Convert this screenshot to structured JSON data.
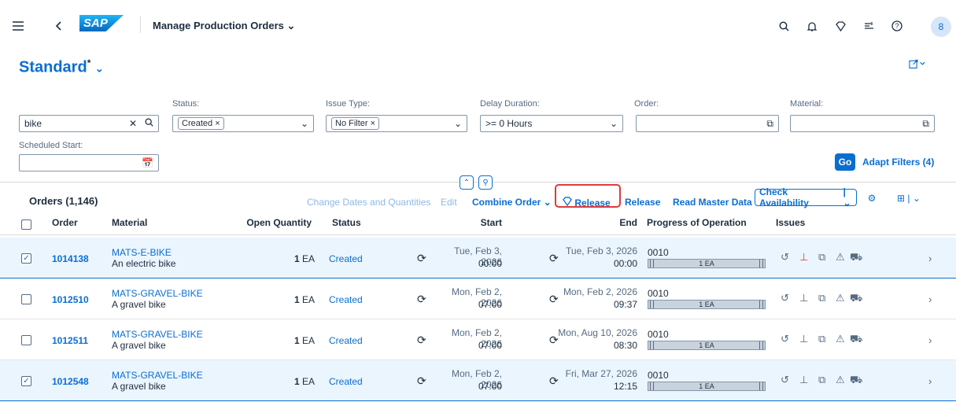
{
  "shell": {
    "logo": "SAP",
    "title": "Manage Production Orders",
    "avatar": "8"
  },
  "variant": {
    "name": "Standard",
    "modified": "*"
  },
  "filters": {
    "search_value": "bike",
    "status_label": "Status:",
    "status_token": "Created",
    "issue_label": "Issue Type:",
    "issue_token": "No Filter",
    "delay_label": "Delay Duration:",
    "delay_value": ">= 0 Hours",
    "order_label": "Order:",
    "material_label": "Material:",
    "sched_label": "Scheduled Start:",
    "go": "Go",
    "adapt": "Adapt Filters (4)"
  },
  "toolbar": {
    "title": "Orders (1,146)",
    "change_dates": "Change Dates and Quantities",
    "edit": "Edit",
    "combine": "Combine Order",
    "release_icon_btn": "Release",
    "release": "Release",
    "read_master": "Read Master Data",
    "check_availability": "Check Availability"
  },
  "columns": {
    "order": "Order",
    "material": "Material",
    "open_qty": "Open Quantity",
    "status": "Status",
    "start": "Start",
    "end": "End",
    "progress": "Progress of Operation",
    "issues": "Issues"
  },
  "rows": [
    {
      "order": "1014138",
      "material": "MATS-E-BIKE",
      "desc": "An electric bike",
      "qty": "1",
      "unit": "EA",
      "status": "Created",
      "start_date": "Tue, Feb 3, 2026",
      "start_time": "00:00",
      "end_date": "Tue, Feb 3, 2026",
      "end_time": "00:00",
      "op": "0010",
      "bar": "1 EA",
      "selected": true
    },
    {
      "order": "1012510",
      "material": "MATS-GRAVEL-BIKE",
      "desc": "A gravel bike",
      "qty": "1",
      "unit": "EA",
      "status": "Created",
      "start_date": "Mon, Feb 2, 2026",
      "start_time": "07:00",
      "end_date": "Mon, Feb 2, 2026",
      "end_time": "09:37",
      "op": "0010",
      "bar": "1 EA",
      "selected": false
    },
    {
      "order": "1012511",
      "material": "MATS-GRAVEL-BIKE",
      "desc": "A gravel bike",
      "qty": "1",
      "unit": "EA",
      "status": "Created",
      "start_date": "Mon, Feb 2, 2026",
      "start_time": "07:00",
      "end_date": "Mon, Aug 10, 2026",
      "end_time": "08:30",
      "op": "0010",
      "bar": "1 EA",
      "selected": false
    },
    {
      "order": "1012548",
      "material": "MATS-GRAVEL-BIKE",
      "desc": "A gravel bike",
      "qty": "1",
      "unit": "EA",
      "status": "Created",
      "start_date": "Mon, Feb 2, 2026",
      "start_time": "07:00",
      "end_date": "Fri, Mar 27, 2026",
      "end_time": "12:15",
      "op": "0010",
      "bar": "1 EA",
      "selected": true
    }
  ],
  "colors": {
    "accent": "#0a6ed1",
    "highlight": "#e0393e",
    "selected_row": "#ebf5fe"
  }
}
